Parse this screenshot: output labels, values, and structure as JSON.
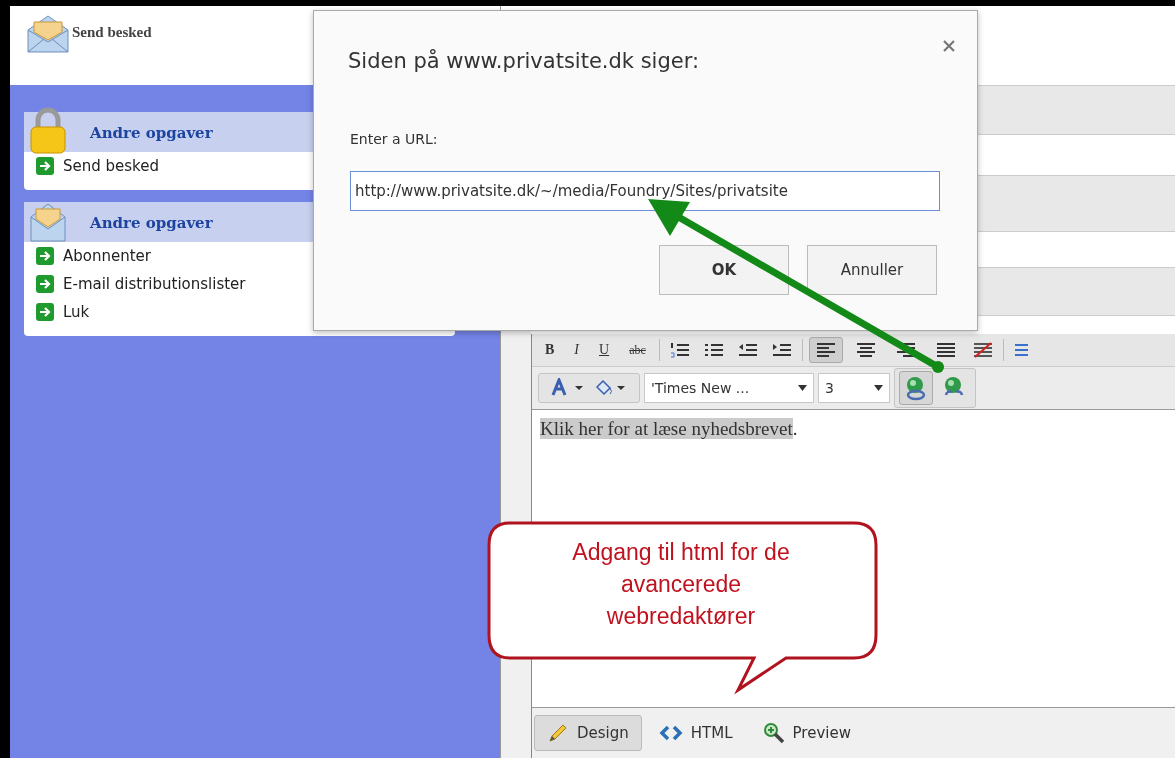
{
  "header": {
    "title": "Send besked"
  },
  "task_panels": [
    {
      "kind": "lock",
      "title": "Andre opgaver",
      "items": [
        "Send besked"
      ]
    },
    {
      "kind": "envelope",
      "title": "Andre opgaver",
      "items": [
        "Abonnenter",
        "E-mail distributionslister",
        "Luk"
      ]
    }
  ],
  "dialog": {
    "title": "Siden på www.privatsite.dk siger:",
    "label": "Enter a URL:",
    "value": "http://www.privatsite.dk/~/media/Foundry/Sites/privatsite",
    "buttons": [
      {
        "label": "OK",
        "kind": "primary"
      },
      {
        "label": "Annuller",
        "kind": "secondary"
      }
    ]
  },
  "toolbar": {
    "format_buttons": [
      {
        "label": "B",
        "kind": "bold"
      },
      {
        "label": "I",
        "kind": "italic"
      },
      {
        "label": "U",
        "kind": "underline"
      },
      {
        "label": "abc",
        "kind": "strike"
      }
    ],
    "align_buttons": [
      {
        "kind": "left",
        "selected": true
      },
      {
        "kind": "center",
        "selected": false
      },
      {
        "kind": "right",
        "selected": false
      },
      {
        "kind": "justify",
        "selected": false
      }
    ],
    "font": "'Times New ...",
    "size": "3"
  },
  "editor": {
    "highlighted_text": "Klik her for at læse nyhedsbrevet",
    "rest_text": "."
  },
  "callout": {
    "text": "Adgang til html for de avancerede webredaktører"
  },
  "mode_tabs": [
    {
      "label": "Design",
      "kind": "design",
      "selected": true
    },
    {
      "label": "HTML",
      "kind": "html",
      "selected": false
    },
    {
      "label": "Preview",
      "kind": "preview",
      "selected": false
    }
  ]
}
